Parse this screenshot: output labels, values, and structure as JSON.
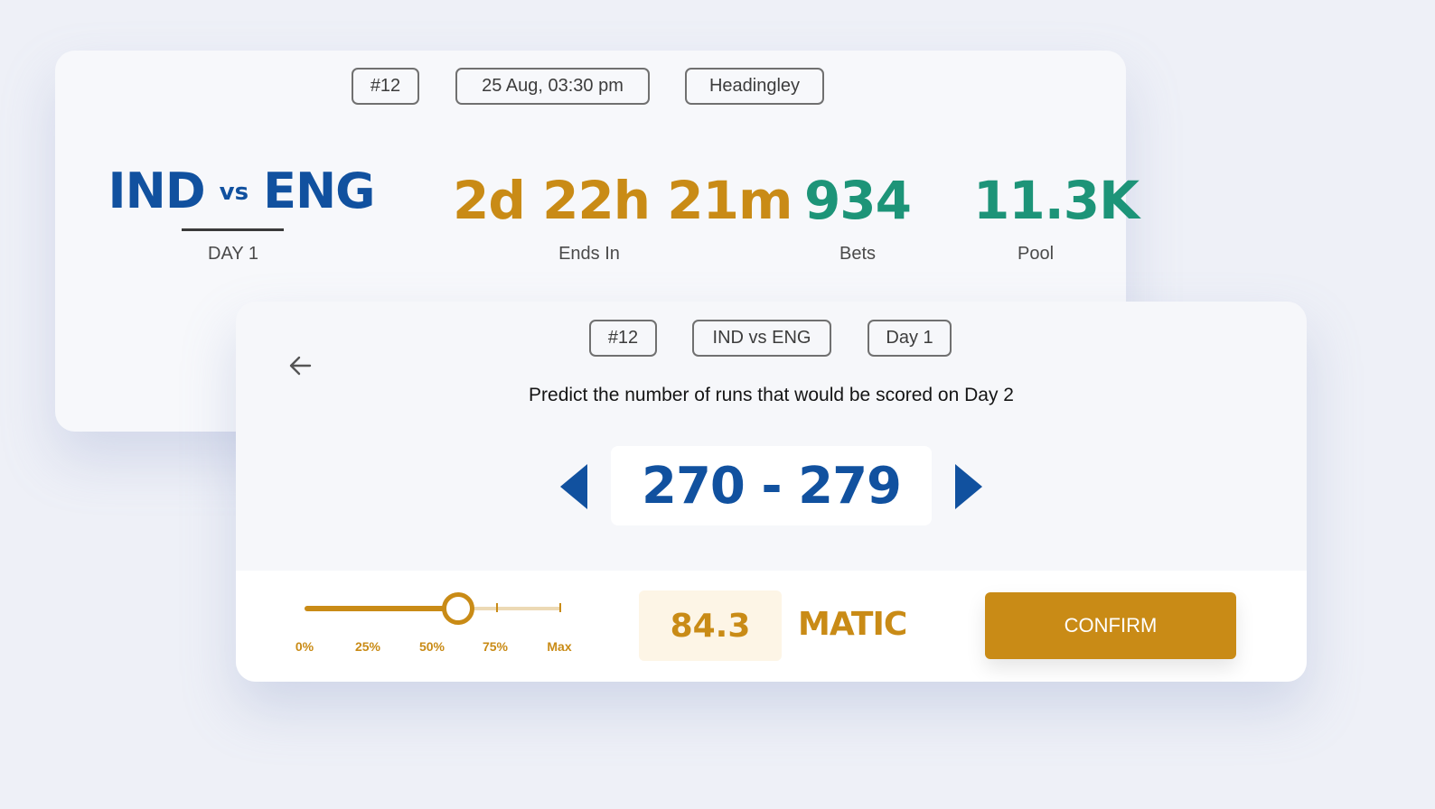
{
  "match_card": {
    "match_no": "#12",
    "datetime": "25 Aug, 03:30 pm",
    "venue": "Headingley",
    "team_a": "IND",
    "vs": "vs",
    "team_b": "ENG",
    "day_label": "DAY 1",
    "countdown": "2d 22h 21m",
    "countdown_label": "Ends In",
    "bets": "934",
    "bets_label": "Bets",
    "pool": "11.3K",
    "pool_label": "Pool"
  },
  "prediction_card": {
    "match_no": "#12",
    "match_name": "IND vs ENG",
    "day": "Day 1",
    "question": "Predict the number of runs that would be scored on Day 2",
    "range": "270 - 279",
    "slider": {
      "value_fraction": 0.6,
      "labels": [
        "0%",
        "25%",
        "50%",
        "75%",
        "Max"
      ]
    },
    "amount": "84.3",
    "currency": "MATIC",
    "confirm_label": "CONFIRM"
  },
  "colors": {
    "brand_blue": "#11519f",
    "gold": "#c98b16",
    "green": "#1d9478",
    "background": "#eef0f7"
  },
  "icons": {
    "back": "arrow-left-icon",
    "prev": "caret-left-icon",
    "next": "caret-right-icon"
  }
}
